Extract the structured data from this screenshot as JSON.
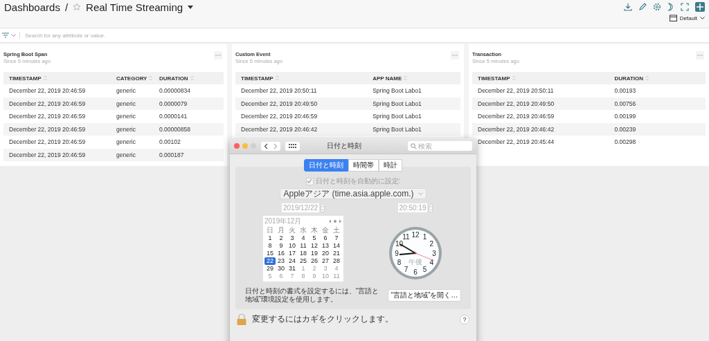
{
  "header": {
    "breadcrumb": "Dashboards",
    "separator": "/",
    "title": "Real Time Streaming",
    "view": "Default"
  },
  "filter": {
    "placeholder": "Search for any attribute or value."
  },
  "widgets": [
    {
      "title": "Spring Boot Span",
      "subtitle": "Since 5 minutes ago",
      "columns": [
        "TIMESTAMP",
        "CATEGORY",
        "DURATION"
      ],
      "rows": [
        [
          "December 22, 2019 20:46:59",
          "generic",
          "0.00000834"
        ],
        [
          "December 22, 2019 20:46:59",
          "generic",
          "0.0000079"
        ],
        [
          "December 22, 2019 20:46:59",
          "generic",
          "0.0000141"
        ],
        [
          "December 22, 2019 20:46:59",
          "generic",
          "0.00000858"
        ],
        [
          "December 22, 2019 20:46:59",
          "generic",
          "0.00102"
        ],
        [
          "December 22, 2019 20:46:59",
          "generic",
          "0.000187"
        ]
      ]
    },
    {
      "title": "Custom Event",
      "subtitle": "Since 5 minutes ago",
      "columns": [
        "TIMESTAMP",
        "APP NAME"
      ],
      "rows": [
        [
          "December 22, 2019 20:50:11",
          "Spring Boot Labo1"
        ],
        [
          "December 22, 2019 20:49:50",
          "Spring Boot Labo1"
        ],
        [
          "December 22, 2019 20:46:59",
          "Spring Boot Labo1"
        ],
        [
          "December 22, 2019 20:46:42",
          "Spring Boot Labo1"
        ]
      ]
    },
    {
      "title": "Transaction",
      "subtitle": "Since 5 minutes ago",
      "columns": [
        "TIMESTAMP",
        "DURATION"
      ],
      "rows": [
        [
          "December 22, 2019 20:50:11",
          "0.00193"
        ],
        [
          "December 22, 2019 20:49:50",
          "0.00756"
        ],
        [
          "December 22, 2019 20:46:59",
          "0.00199"
        ],
        [
          "December 22, 2019 20:46:42",
          "0.00239"
        ],
        [
          "December 22, 2019 20:45:44",
          "0.00298"
        ]
      ]
    }
  ],
  "dialog": {
    "title": "日付と時刻",
    "window_buttons": [
      {
        "color": "#fc605c"
      },
      {
        "color": "#fdbc40"
      },
      {
        "color": "#d0d0d0"
      }
    ],
    "search": {
      "placeholder": "検索"
    },
    "tabs": [
      {
        "label": "日付と時刻",
        "selected": true
      },
      {
        "label": "時間帯",
        "selected": false
      },
      {
        "label": "時計",
        "selected": false
      }
    ],
    "auto_set": {
      "label": "日付と時刻を自動的に設定:",
      "checked": true,
      "disabled": true,
      "server": "Appleアジア (time.asia.apple.com.)"
    },
    "date": "2019/12/22",
    "time": "20:50:19",
    "calendar": {
      "month": "2019年12月",
      "weekdays": [
        "日",
        "月",
        "火",
        "水",
        "木",
        "金",
        "土"
      ],
      "weeks": [
        [
          {
            "day": "1",
            "muted": false,
            "selected": false
          },
          {
            "day": "2",
            "muted": false,
            "selected": false
          },
          {
            "day": "3",
            "muted": false,
            "selected": false
          },
          {
            "day": "4",
            "muted": false,
            "selected": false
          },
          {
            "day": "5",
            "muted": false,
            "selected": false
          },
          {
            "day": "6",
            "muted": false,
            "selected": false
          },
          {
            "day": "7",
            "muted": false,
            "selected": false
          }
        ],
        [
          {
            "day": "8",
            "muted": false,
            "selected": false
          },
          {
            "day": "9",
            "muted": false,
            "selected": false
          },
          {
            "day": "10",
            "muted": false,
            "selected": false
          },
          {
            "day": "11",
            "muted": false,
            "selected": false
          },
          {
            "day": "12",
            "muted": false,
            "selected": false
          },
          {
            "day": "13",
            "muted": false,
            "selected": false
          },
          {
            "day": "14",
            "muted": false,
            "selected": false
          }
        ],
        [
          {
            "day": "15",
            "muted": false,
            "selected": false
          },
          {
            "day": "16",
            "muted": false,
            "selected": false
          },
          {
            "day": "17",
            "muted": false,
            "selected": false
          },
          {
            "day": "18",
            "muted": false,
            "selected": false
          },
          {
            "day": "19",
            "muted": false,
            "selected": false
          },
          {
            "day": "20",
            "muted": false,
            "selected": false
          },
          {
            "day": "21",
            "muted": false,
            "selected": false
          }
        ],
        [
          {
            "day": "22",
            "muted": false,
            "selected": true
          },
          {
            "day": "23",
            "muted": false,
            "selected": false
          },
          {
            "day": "24",
            "muted": false,
            "selected": false
          },
          {
            "day": "25",
            "muted": false,
            "selected": false
          },
          {
            "day": "26",
            "muted": false,
            "selected": false
          },
          {
            "day": "27",
            "muted": false,
            "selected": false
          },
          {
            "day": "28",
            "muted": false,
            "selected": false
          }
        ],
        [
          {
            "day": "29",
            "muted": false,
            "selected": false
          },
          {
            "day": "30",
            "muted": false,
            "selected": false
          },
          {
            "day": "31",
            "muted": false,
            "selected": false
          },
          {
            "day": "1",
            "muted": true,
            "selected": false
          },
          {
            "day": "2",
            "muted": true,
            "selected": false
          },
          {
            "day": "3",
            "muted": true,
            "selected": false
          },
          {
            "day": "4",
            "muted": true,
            "selected": false
          }
        ],
        [
          {
            "day": "5",
            "muted": true,
            "selected": false
          },
          {
            "day": "6",
            "muted": true,
            "selected": false
          },
          {
            "day": "7",
            "muted": true,
            "selected": false
          },
          {
            "day": "8",
            "muted": true,
            "selected": false
          },
          {
            "day": "9",
            "muted": true,
            "selected": false
          },
          {
            "day": "10",
            "muted": true,
            "selected": false
          },
          {
            "day": "11",
            "muted": true,
            "selected": false
          }
        ]
      ]
    },
    "clock": {
      "numerals": [
        "11",
        "12",
        "1",
        "10",
        "2",
        "9",
        "3",
        "8",
        "4",
        "7",
        "6",
        "5"
      ],
      "period": "午後"
    },
    "format_note": "日付と時刻の書式を設定するには、“言語と地域”環境設定を使用します。",
    "format_button": "“言語と地域”を開く…",
    "lock_note": "変更するにはカギをクリックします。",
    "help": "?"
  }
}
